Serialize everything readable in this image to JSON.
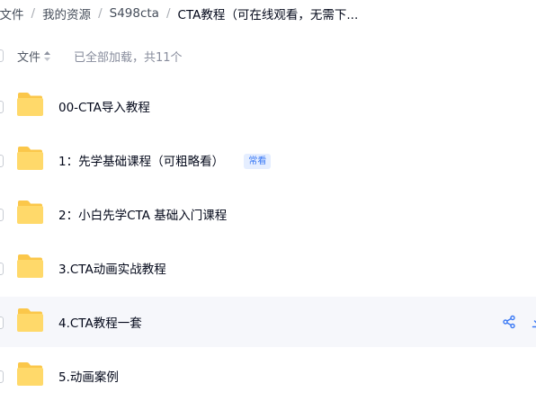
{
  "breadcrumb": [
    {
      "label": "部文件",
      "current": false
    },
    {
      "label": "我的资源",
      "current": false
    },
    {
      "label": "S498cta",
      "current": false
    },
    {
      "label": "CTA教程（可在线观看，无需下...",
      "current": true
    }
  ],
  "breadcrumb_separator": "/",
  "list_header": {
    "name_column": "文件",
    "load_status": "已全部加载，共11个"
  },
  "files": [
    {
      "name": "00-CTA导入教程",
      "type": "folder"
    },
    {
      "name": "1：先学基础课程（可粗略看）",
      "type": "folder",
      "badge": "常看"
    },
    {
      "name": "2：小白先学CTA 基础入门课程",
      "type": "folder"
    },
    {
      "name": "3.CTA动画实战教程",
      "type": "folder"
    },
    {
      "name": "4.CTA教程一套",
      "type": "folder",
      "hovered": true
    },
    {
      "name": "5.动画案例",
      "type": "folder"
    }
  ],
  "row_actions": [
    "share-icon",
    "download-icon"
  ],
  "colors": {
    "folder": "#ffd96a",
    "folder_back": "#fbc74a",
    "accent": "#3a79f5",
    "hover_row": "#f6f7fb"
  }
}
